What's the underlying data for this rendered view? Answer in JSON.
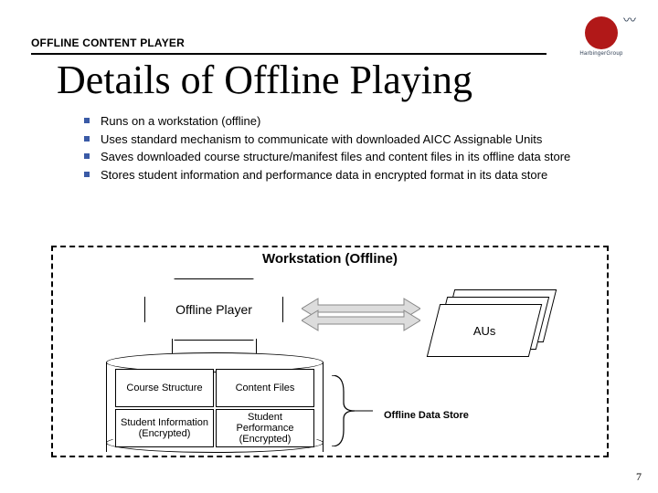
{
  "header": "OFFLINE CONTENT PLAYER",
  "logo_text": "HarbingerGroup",
  "title": "Details of Offline Playing",
  "bullets": [
    "Runs on a workstation (offline)",
    "Uses standard mechanism to communicate with downloaded AICC Assignable Units",
    "Saves downloaded course structure/manifest files and content files in its offline data store",
    "Stores student information and performance data in encrypted format in its data store"
  ],
  "diagram": {
    "title": "Workstation (Offline)",
    "player": "Offline Player",
    "aus": "AUs",
    "store_label": "Offline Data Store",
    "cells": {
      "course_structure": "Course Structure",
      "content_files": "Content Files",
      "student_info": "Student Information (Encrypted)",
      "student_perf": "Student Performance (Encrypted)"
    }
  },
  "page_number": "7"
}
